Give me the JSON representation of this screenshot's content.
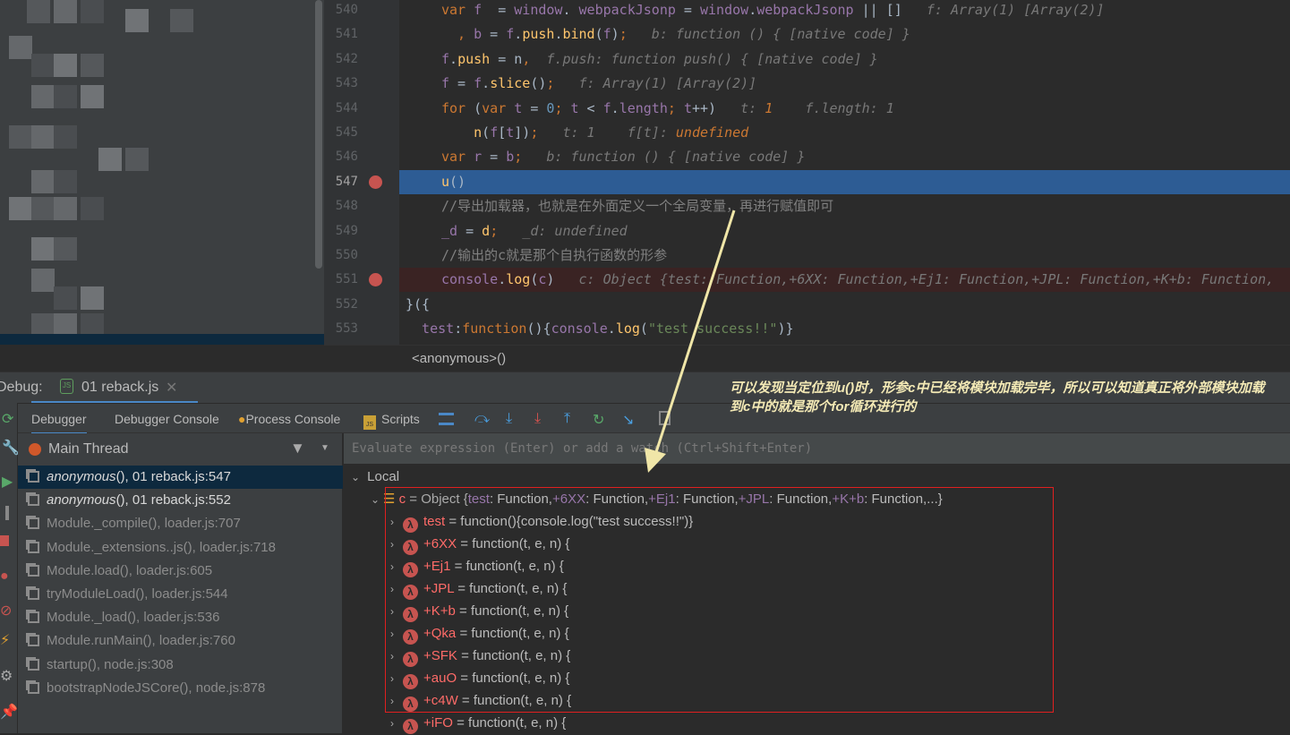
{
  "editor": {
    "lines": [
      {
        "no": "540",
        "html_parts": [
          [
            "k",
            "var "
          ],
          [
            "v",
            "f"
          ],
          [
            "",
            "  = "
          ],
          [
            "v",
            "window"
          ],
          [
            "",
            ". "
          ],
          [
            "v",
            "webpackJsonp"
          ],
          [
            "",
            " = "
          ],
          [
            "v",
            "window"
          ],
          [
            "",
            "."
          ],
          [
            "v",
            "webpackJsonp"
          ],
          [
            "",
            " || []   "
          ],
          [
            "h",
            "f: Array(1) [Array(2)]"
          ]
        ]
      },
      {
        "no": "541",
        "html_parts": [
          [
            "k",
            "  , "
          ],
          [
            "v",
            "b"
          ],
          [
            "",
            " = "
          ],
          [
            "v",
            "f"
          ],
          [
            "",
            "."
          ],
          [
            "f",
            "push"
          ],
          [
            "",
            "."
          ],
          [
            "f",
            "bind"
          ],
          [
            "",
            "("
          ],
          [
            "v",
            "f"
          ],
          [
            "",
            ")"
          ],
          [
            "k",
            ";"
          ],
          [
            "h",
            "   b: function () { [native code] }"
          ]
        ]
      },
      {
        "no": "542",
        "html_parts": [
          [
            "v",
            "f"
          ],
          [
            "",
            "."
          ],
          [
            "f",
            "push"
          ],
          [
            "",
            " = "
          ],
          [
            "",
            "n"
          ],
          [
            "k",
            ","
          ],
          [
            "h",
            "  f.push: function push() { [native code] }"
          ]
        ]
      },
      {
        "no": "543",
        "html_parts": [
          [
            "v",
            "f"
          ],
          [
            "",
            " = "
          ],
          [
            "v",
            "f"
          ],
          [
            "",
            "."
          ],
          [
            "f",
            "slice"
          ],
          [
            "",
            "()"
          ],
          [
            "k",
            ";"
          ],
          [
            "h",
            "   f: Array(1) [Array(2)]"
          ]
        ]
      },
      {
        "no": "544",
        "html_parts": [
          [
            "k",
            "for "
          ],
          [
            "",
            "("
          ],
          [
            "k",
            "var "
          ],
          [
            "v",
            "t"
          ],
          [
            "",
            " = "
          ],
          [
            "n",
            "0"
          ],
          [
            "k",
            "; "
          ],
          [
            "v",
            "t"
          ],
          [
            "",
            " < "
          ],
          [
            "v",
            "f"
          ],
          [
            "",
            "."
          ],
          [
            "v",
            "length"
          ],
          [
            "k",
            "; "
          ],
          [
            "v",
            "t"
          ],
          [
            "",
            "++)   "
          ],
          [
            "h",
            "t: "
          ],
          [
            "hv",
            "1"
          ],
          [
            "h",
            "    f.length: 1"
          ]
        ]
      },
      {
        "no": "545",
        "html_parts": [
          [
            "f",
            "    n"
          ],
          [
            "",
            "("
          ],
          [
            "v",
            "f"
          ],
          [
            "",
            "["
          ],
          [
            "v",
            "t"
          ],
          [
            "",
            "])"
          ],
          [
            "k",
            ";"
          ],
          [
            "h",
            "   t: 1    f[t]: "
          ],
          [
            "hv",
            "undefined"
          ]
        ]
      },
      {
        "no": "546",
        "html_parts": [
          [
            "k",
            "var "
          ],
          [
            "v",
            "r"
          ],
          [
            "",
            " = "
          ],
          [
            "v",
            "b"
          ],
          [
            "k",
            ";"
          ],
          [
            "h",
            "   b: function () { [native code] }"
          ]
        ]
      },
      {
        "no": "547",
        "html_parts": [
          [
            "f",
            "u"
          ],
          [
            "",
            "()"
          ]
        ]
      },
      {
        "no": "548",
        "html_parts": [
          [
            "cm",
            "//导出加载器，也就是在外面定义一个全局变量，再进行赋值即可"
          ]
        ]
      },
      {
        "no": "549",
        "html_parts": [
          [
            "v",
            "_d"
          ],
          [
            "",
            " = "
          ],
          [
            "f",
            "d"
          ],
          [
            "k",
            ";"
          ],
          [
            "h",
            "   _d: undefined"
          ]
        ]
      },
      {
        "no": "550",
        "html_parts": [
          [
            "cm",
            "//输出的c就是那个自执行函数的形参"
          ]
        ]
      },
      {
        "no": "551",
        "html_parts": [
          [
            "v",
            "console"
          ],
          [
            "",
            "."
          ],
          [
            "f",
            "log"
          ],
          [
            "",
            "("
          ],
          [
            "v",
            "c"
          ],
          [
            "",
            ")"
          ],
          [
            "h",
            "   c: Object {test: Function,+6XX: Function,+Ej1: Function,+JPL: Function,+K+b: Function,"
          ]
        ]
      },
      {
        "no": "552",
        "html_parts": [
          [
            "",
            "}({"
          ]
        ]
      },
      {
        "no": "553",
        "html_parts": [
          [
            "v",
            "  test"
          ],
          [
            "",
            ":"
          ],
          [
            "k",
            "function"
          ],
          [
            "",
            "(){"
          ],
          [
            "v",
            "console"
          ],
          [
            "",
            "."
          ],
          [
            "f",
            "log"
          ],
          [
            "",
            "("
          ],
          [
            "s",
            "\"test success!!\""
          ],
          [
            "",
            ")}"
          ]
        ]
      }
    ],
    "current_line": "547",
    "breakpoint_lines": [
      "547",
      "551"
    ],
    "breadcrumb": "<anonymous>()"
  },
  "debug": {
    "label": "Debug:",
    "session_tab": "01 reback.js",
    "tabs": [
      "Debugger",
      "Debugger Console",
      "Process Console",
      "Scripts"
    ],
    "thread": "Main Thread",
    "eval_placeholder": "Evaluate expression (Enter) or add a watch (Ctrl+Shift+Enter)",
    "frames": [
      {
        "fn": "anonymous",
        "rest": "(), 01 reback.js:547",
        "italic": true
      },
      {
        "fn": "anonymous",
        "rest": "(), 01 reback.js:552",
        "italic": true
      },
      {
        "fn": "",
        "rest": "Module._compile(), loader.js:707"
      },
      {
        "fn": "",
        "rest": "Module._extensions..js(), loader.js:718"
      },
      {
        "fn": "",
        "rest": "Module.load(), loader.js:605"
      },
      {
        "fn": "",
        "rest": "tryModuleLoad(), loader.js:544"
      },
      {
        "fn": "",
        "rest": "Module._load(), loader.js:536"
      },
      {
        "fn": "",
        "rest": "Module.runMain(), loader.js:760"
      },
      {
        "fn": "",
        "rest": "startup(), node.js:308"
      },
      {
        "fn": "",
        "rest": "bootstrapNodeJSCore(), node.js:878"
      }
    ],
    "scope": "Local",
    "object_var": {
      "name": "c",
      "value": " = Object {",
      "props": [
        "test",
        "+6XX",
        "+Ej1",
        "+JPL",
        "+K+b"
      ],
      "suffix": "...}"
    },
    "children": [
      {
        "name": "test",
        "value": " = function(){console.log(\"test success!!\")}"
      },
      {
        "name": "+6XX",
        "value": " = function(t, e, n) {"
      },
      {
        "name": "+Ej1",
        "value": " = function(t, e, n) {"
      },
      {
        "name": "+JPL",
        "value": " = function(t, e, n) {"
      },
      {
        "name": "+K+b",
        "value": " = function(t, e, n) {"
      },
      {
        "name": "+Qka",
        "value": " = function(t, e, n) {"
      },
      {
        "name": "+SFK",
        "value": " = function(t, e, n) {"
      },
      {
        "name": "+auO",
        "value": " = function(t, e, n) {"
      },
      {
        "name": "+c4W",
        "value": " = function(t, e, n) {"
      },
      {
        "name": "+iFO",
        "value": " = function(t, e, n) {"
      }
    ]
  },
  "annotation": {
    "text": "可以发现当定位到u()时，形参c中已经将模块加载完毕，所以可以知道真正将外部模块加载到c中的就是那个for循环进行的",
    "color": "#f3e9b5",
    "box_color": "#e02020"
  },
  "colors": {
    "keyword": "#cc7832",
    "variable": "#9876aa",
    "function": "#ffc66d",
    "current_line": "#2d5c94",
    "breakpoint_line": "#3a2323",
    "breakpoint": "#c75450"
  }
}
